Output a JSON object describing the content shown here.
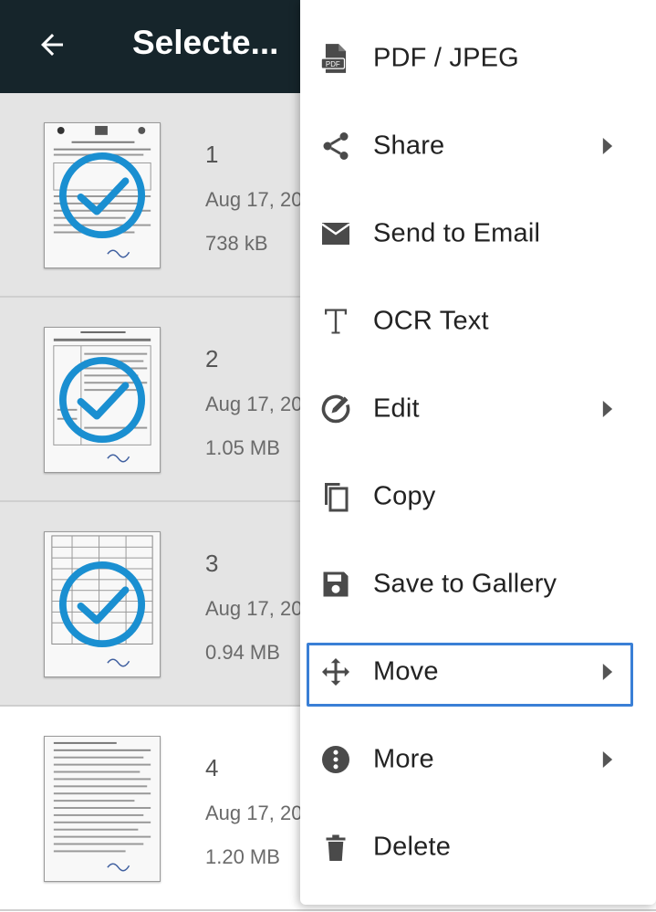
{
  "header": {
    "title": "Selecte...",
    "back_icon": "arrow-back-icon",
    "background": "#16252b"
  },
  "documents": [
    {
      "number": "1",
      "date": "Aug 17, 20",
      "size": "738 kB",
      "selected": true
    },
    {
      "number": "2",
      "date": "Aug 17, 20",
      "size": "1.05 MB",
      "selected": true
    },
    {
      "number": "3",
      "date": "Aug 17, 20",
      "size": "0.94 MB",
      "selected": true
    },
    {
      "number": "4",
      "date": "Aug 17, 20",
      "size": "1.20 MB",
      "selected": false
    }
  ],
  "menu": {
    "items": [
      {
        "label": "PDF / JPEG",
        "icon": "pdf-icon",
        "submenu": false
      },
      {
        "label": "Share",
        "icon": "share-icon",
        "submenu": true
      },
      {
        "label": "Send to Email",
        "icon": "email-icon",
        "submenu": false
      },
      {
        "label": "OCR Text",
        "icon": "ocr-text-icon",
        "submenu": false
      },
      {
        "label": "Edit",
        "icon": "edit-icon",
        "submenu": true
      },
      {
        "label": "Copy",
        "icon": "copy-icon",
        "submenu": false
      },
      {
        "label": "Save to Gallery",
        "icon": "save-icon",
        "submenu": false
      },
      {
        "label": "Move",
        "icon": "move-icon",
        "submenu": true,
        "focused": true
      },
      {
        "label": "More",
        "icon": "more-icon",
        "submenu": true
      },
      {
        "label": "Delete",
        "icon": "delete-icon",
        "submenu": false
      }
    ]
  },
  "colors": {
    "selection_check": "#1a8fd1",
    "selected_row": "#e4e4e4",
    "focus_ring": "#3a7fd6",
    "icon": "#4a4a4a"
  }
}
